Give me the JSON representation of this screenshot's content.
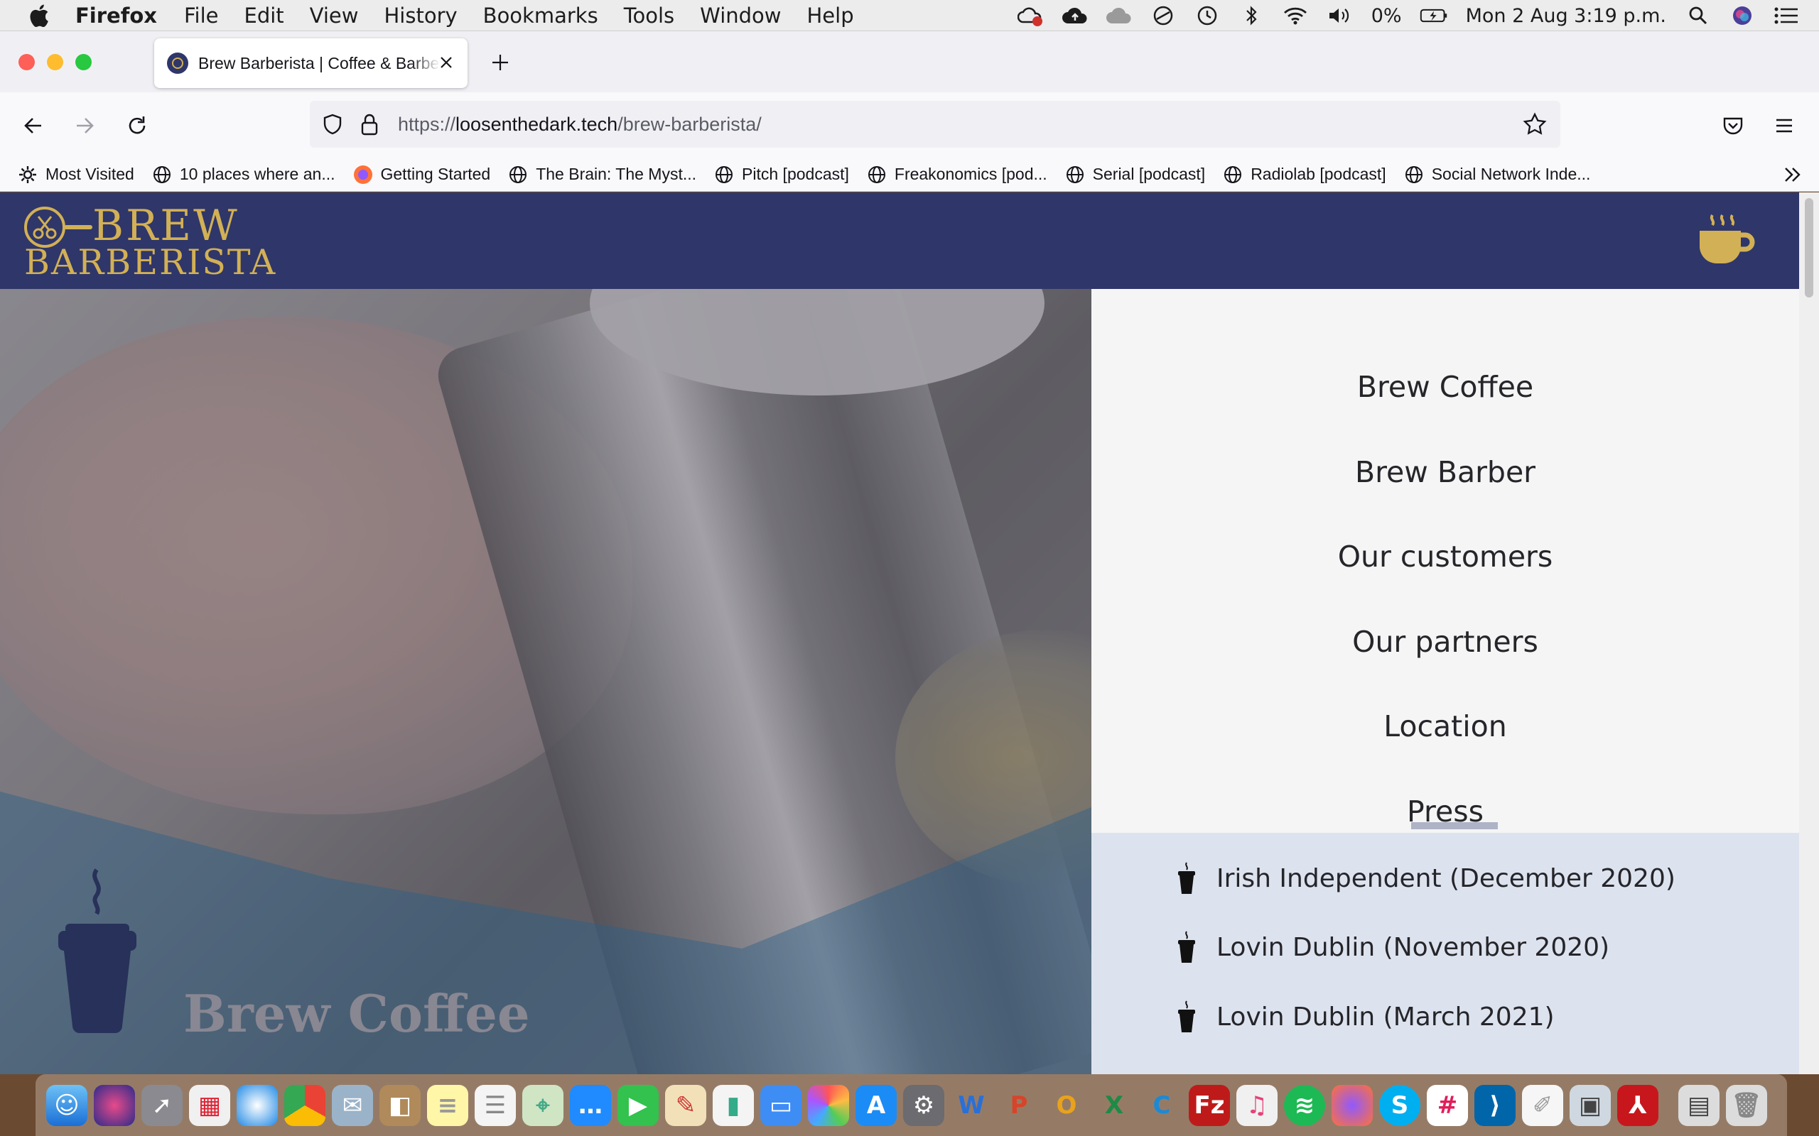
{
  "menubar": {
    "app_name": "Firefox",
    "menus": [
      "File",
      "Edit",
      "View",
      "History",
      "Bookmarks",
      "Tools",
      "Window",
      "Help"
    ],
    "battery": "0%",
    "datetime": "Mon 2 Aug  3:19 p.m."
  },
  "browser": {
    "tab_title": "Brew Barberista | Coffee & Barber",
    "url_prefix": "https://",
    "url_host": "loosenthedark.tech",
    "url_path": "/brew-barberista/",
    "bookmarks": [
      {
        "label": "Most Visited",
        "icon": "gear-icon"
      },
      {
        "label": "10 places where an...",
        "icon": "globe-icon"
      },
      {
        "label": "Getting Started",
        "icon": "firefox-icon"
      },
      {
        "label": "The Brain: The Myst...",
        "icon": "globe-icon"
      },
      {
        "label": "Pitch [podcast]",
        "icon": "globe-icon"
      },
      {
        "label": "Freakonomics [pod...",
        "icon": "globe-icon"
      },
      {
        "label": "Serial [podcast]",
        "icon": "globe-icon"
      },
      {
        "label": "Radiolab [podcast]",
        "icon": "globe-icon"
      },
      {
        "label": "Social Network Inde...",
        "icon": "globe-icon"
      }
    ]
  },
  "site": {
    "logo_line1": "BREW",
    "logo_line2": "BARBERISTA",
    "hero_title": "Brew Coffee",
    "menu": [
      "Brew Coffee",
      "Brew Barber",
      "Our customers",
      "Our partners",
      "Location",
      "Press"
    ],
    "press_items": [
      "Irish Independent (December 2020)",
      "Lovin Dublin (November 2020)",
      "Lovin Dublin (March 2021)"
    ]
  },
  "colors": {
    "header": "#2f3669",
    "gold": "#d2b055",
    "press_panel": "#dde3ee"
  }
}
